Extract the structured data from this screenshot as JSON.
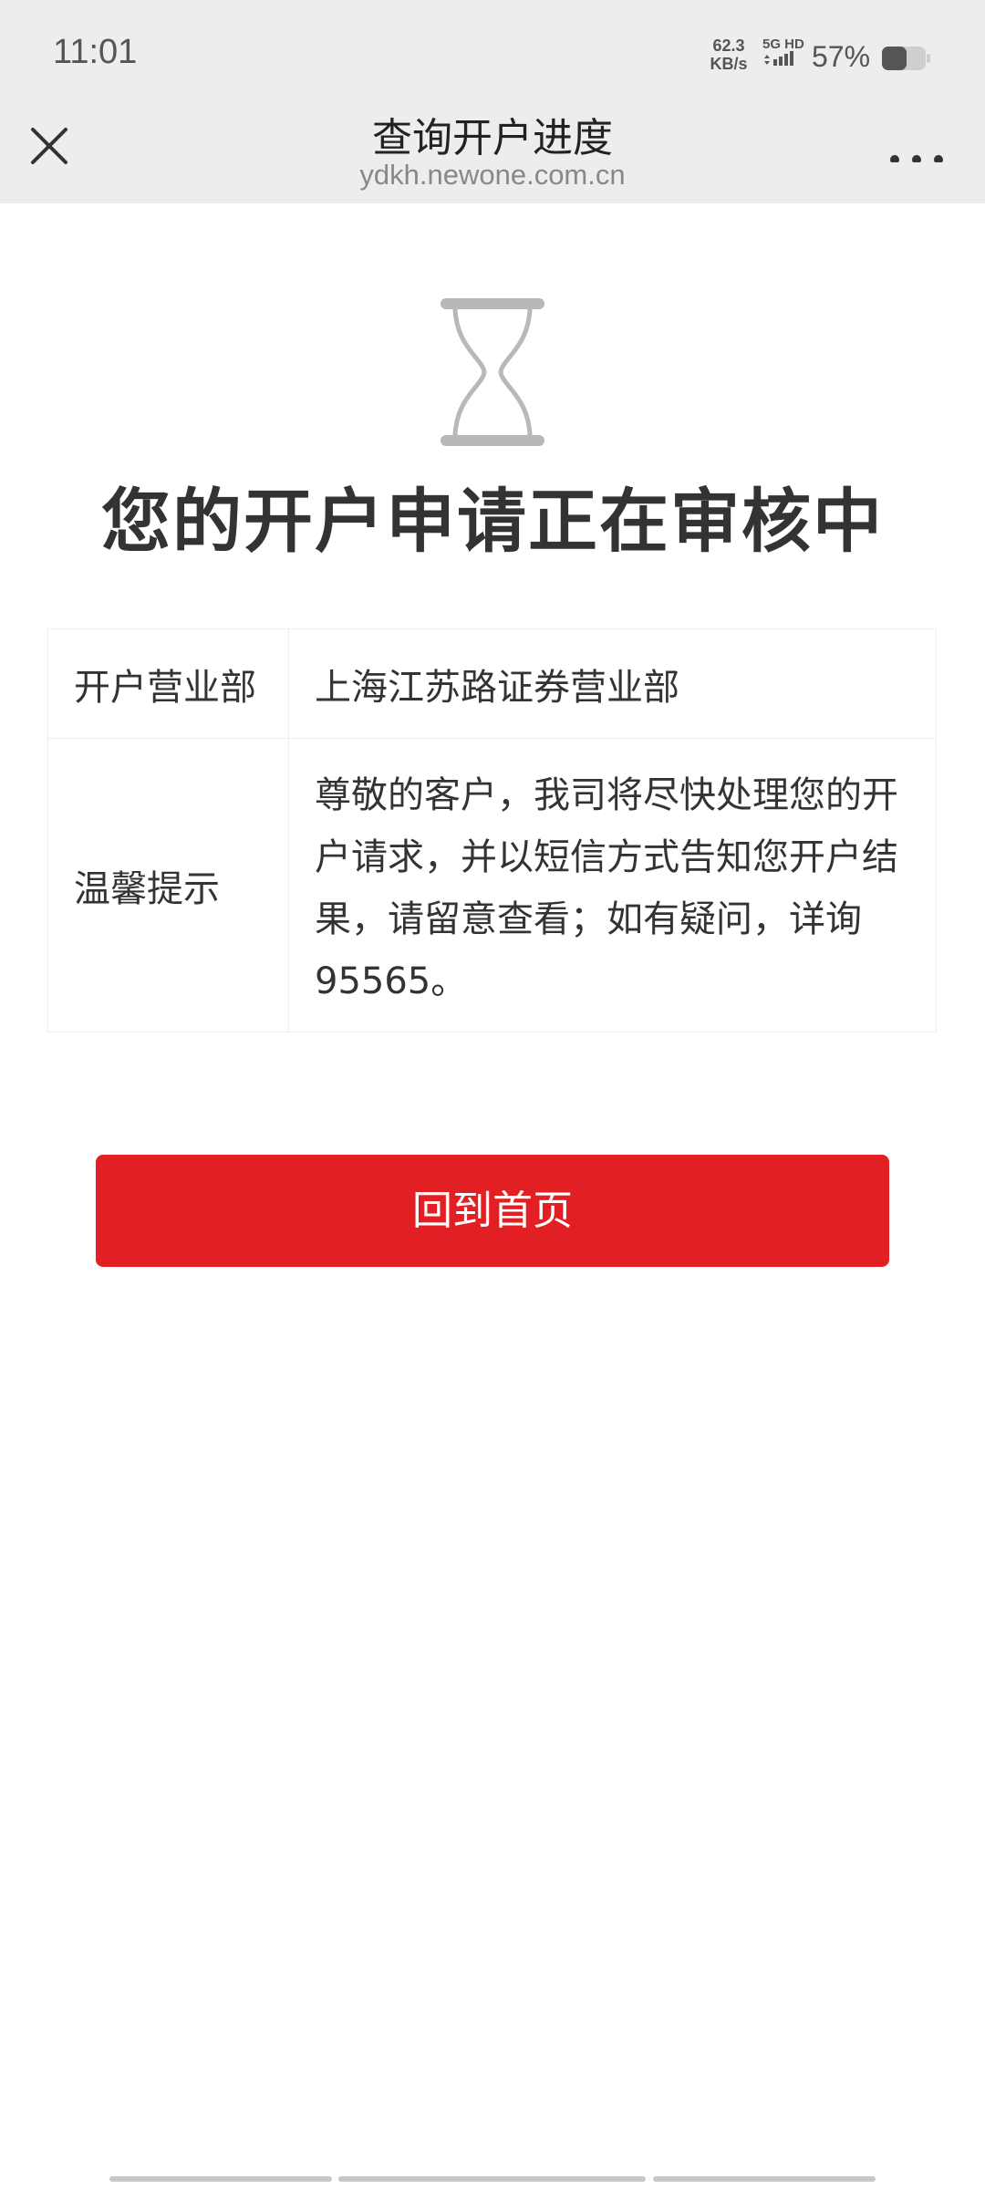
{
  "status_bar": {
    "time": "11:01",
    "net_speed_value": "62.3",
    "net_speed_unit": "KB/s",
    "network_label": "5G HD",
    "battery_percent": "57%",
    "battery_level": 0.57
  },
  "nav": {
    "title": "查询开户进度",
    "url": "ydkh.newone.com.cn",
    "close_icon": "close-icon",
    "more_icon": "more-dots-icon"
  },
  "main": {
    "status_icon": "hourglass-icon",
    "headline": "您的开户申请正在审核中",
    "info_rows": [
      {
        "label": "开户营业部",
        "value": "上海江苏路证券营业部"
      },
      {
        "label": "温馨提示",
        "value": "尊敬的客户，我司将尽快处理您的开户请求，并以短信方式告知您开户结果，请留意查看；如有疑问，详询95565。"
      }
    ],
    "home_button_label": "回到首页"
  },
  "colors": {
    "accent": "#e22024",
    "bar_background": "#ededed",
    "icon_gray": "#b8b8b8"
  }
}
